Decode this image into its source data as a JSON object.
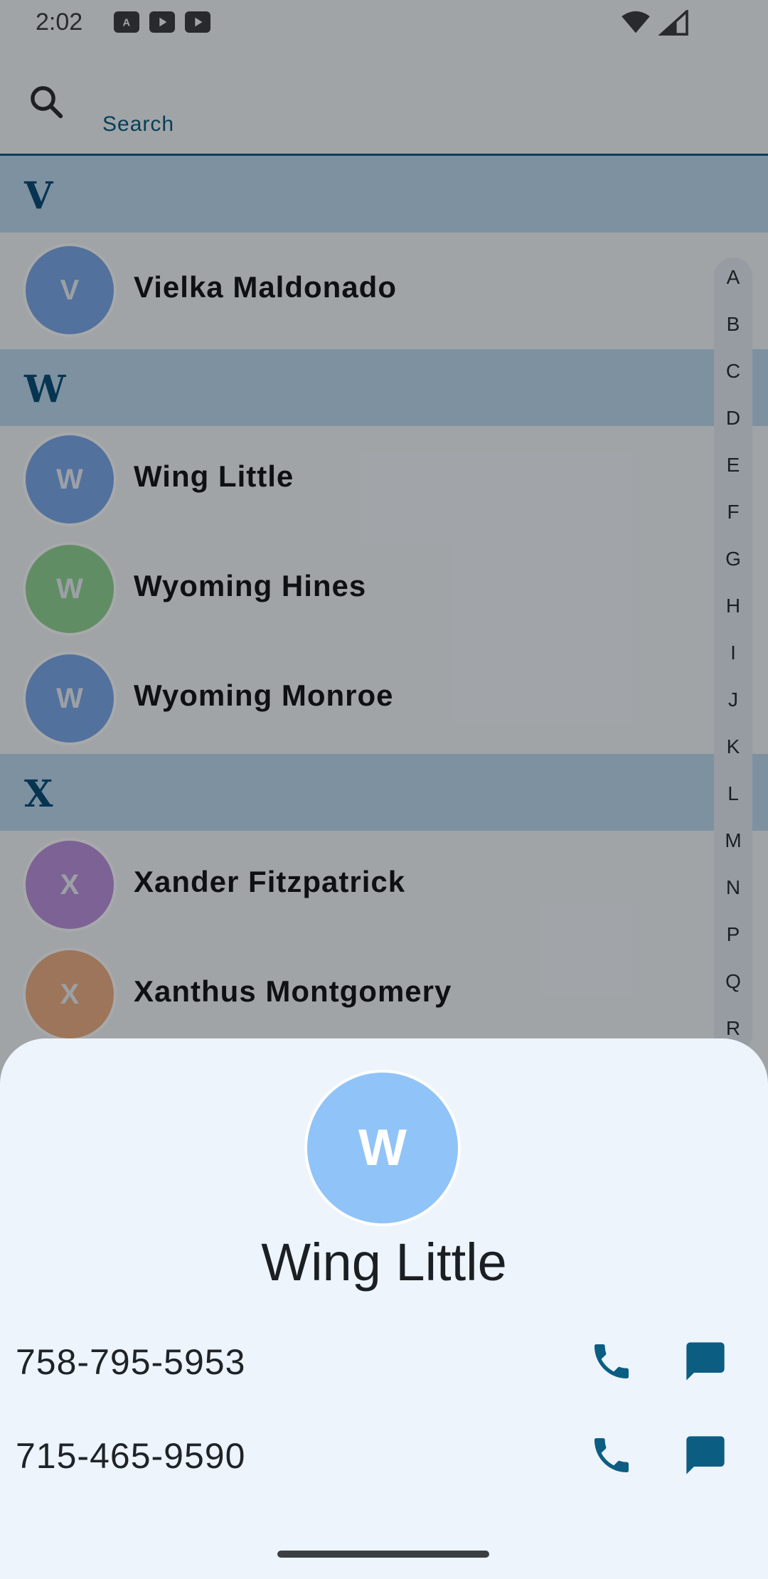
{
  "status": {
    "time": "2:02"
  },
  "search": {
    "label": "Search"
  },
  "sections": [
    {
      "letter": "V"
    },
    {
      "letter": "W"
    },
    {
      "letter": "X"
    }
  ],
  "contacts": [
    {
      "initial": "V",
      "name": "Vielka Maldonado",
      "color": "#7aa7e8"
    },
    {
      "initial": "W",
      "name": "Wing Little",
      "color": "#7aa7e8"
    },
    {
      "initial": "W",
      "name": "Wyoming Hines",
      "color": "#8fd095"
    },
    {
      "initial": "W",
      "name": "Wyoming Monroe",
      "color": "#7aa7e8"
    },
    {
      "initial": "X",
      "name": "Xander Fitzpatrick",
      "color": "#b991de"
    },
    {
      "initial": "X",
      "name": "Xanthus Montgomery",
      "color": "#e8ad85"
    }
  ],
  "index_letters": [
    "A",
    "B",
    "C",
    "D",
    "E",
    "F",
    "G",
    "H",
    "I",
    "J",
    "K",
    "L",
    "M",
    "N",
    "P",
    "Q",
    "R"
  ],
  "sheet": {
    "initial": "W",
    "name": "Wing Little",
    "phones": [
      {
        "number": "758-795-5953"
      },
      {
        "number": "715-465-9590"
      }
    ]
  },
  "colors": {
    "accent": "#0b5d82",
    "section_bg": "#b8d6ee",
    "sheet_bg": "#edf4fb"
  }
}
